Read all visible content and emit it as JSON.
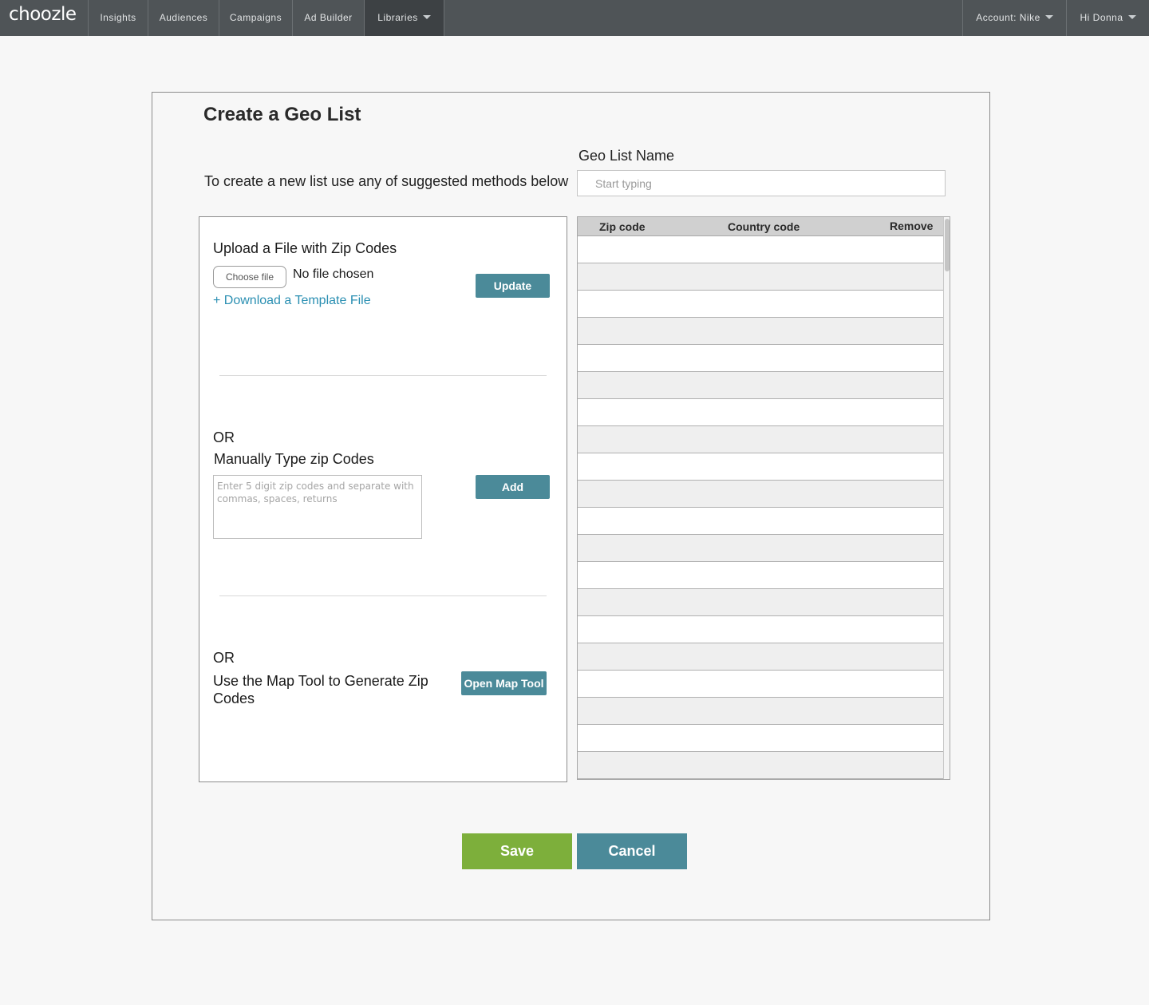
{
  "nav": {
    "logo": "choozle",
    "items": [
      {
        "label": "Insights"
      },
      {
        "label": "Audiences"
      },
      {
        "label": "Campaigns"
      },
      {
        "label": "Ad Builder"
      },
      {
        "label": "Libraries"
      }
    ],
    "account": "Account: Nike",
    "user": "Hi Donna"
  },
  "page": {
    "title": "Create a Geo List",
    "intro": "To create a new list use any of suggested methods below",
    "name_label": "Geo List Name",
    "name_placeholder": "Start typing"
  },
  "upload": {
    "title": "Upload a File with Zip Codes",
    "choose_label": "Choose file",
    "no_file": "No file chosen",
    "template_link": "+ Download a Template File",
    "update_label": "Update"
  },
  "manual": {
    "or": "OR",
    "title": "Manually Type zip Codes",
    "placeholder": "Enter 5 digit zip codes and separate with commas, spaces, returns",
    "add_label": "Add"
  },
  "map": {
    "or": "OR",
    "title": "Use the Map Tool to Generate Zip Codes",
    "button_label": "Open Map Tool"
  },
  "table": {
    "columns": [
      "Zip code",
      "Country code",
      "Remove"
    ],
    "rows": [
      {
        "zip": "",
        "country": ""
      },
      {
        "zip": "",
        "country": ""
      },
      {
        "zip": "",
        "country": ""
      },
      {
        "zip": "",
        "country": ""
      },
      {
        "zip": "",
        "country": ""
      },
      {
        "zip": "",
        "country": ""
      },
      {
        "zip": "",
        "country": ""
      },
      {
        "zip": "",
        "country": ""
      },
      {
        "zip": "",
        "country": ""
      },
      {
        "zip": "",
        "country": ""
      },
      {
        "zip": "",
        "country": ""
      },
      {
        "zip": "",
        "country": ""
      },
      {
        "zip": "",
        "country": ""
      },
      {
        "zip": "",
        "country": ""
      },
      {
        "zip": "",
        "country": ""
      },
      {
        "zip": "",
        "country": ""
      },
      {
        "zip": "",
        "country": ""
      },
      {
        "zip": "",
        "country": ""
      },
      {
        "zip": "",
        "country": ""
      },
      {
        "zip": "",
        "country": ""
      }
    ]
  },
  "actions": {
    "save": "Save",
    "cancel": "Cancel"
  }
}
